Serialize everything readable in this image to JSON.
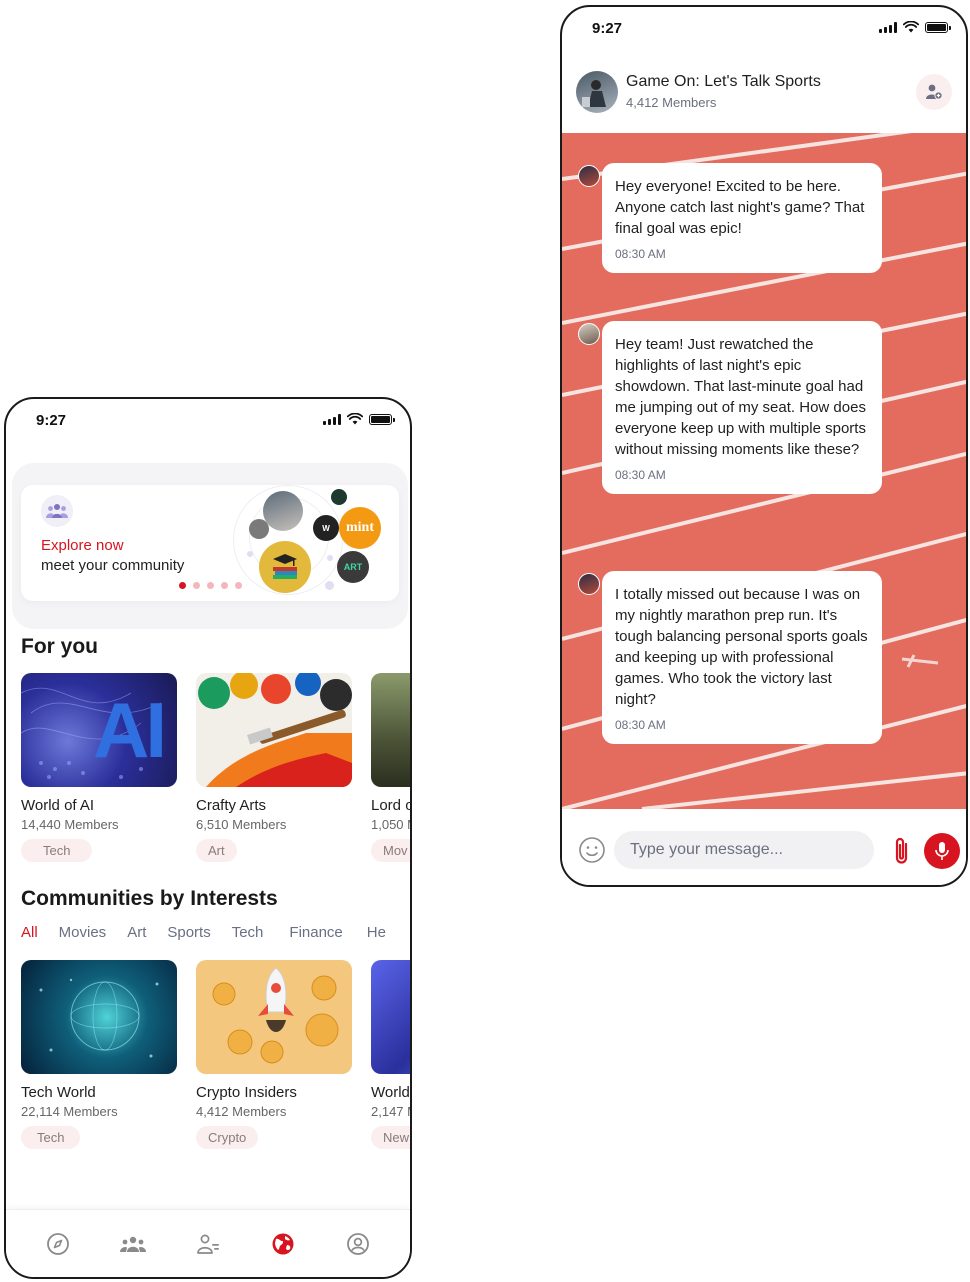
{
  "left_phone": {
    "status": {
      "time": "9:27"
    },
    "banner": {
      "explore": "Explore now",
      "meet": "meet your community",
      "dots_total": 5,
      "dots_active": 1,
      "bubble_labels": {
        "mint": "mint",
        "art": "ART"
      }
    },
    "for_you": {
      "title": "For you",
      "cards": [
        {
          "name": "World of AI",
          "members": "14,440 Members",
          "tag": "Tech",
          "image_text": "AI"
        },
        {
          "name": "Crafty Arts",
          "members": "6,510 Members",
          "tag": "Art"
        },
        {
          "name": "Lord o",
          "members": "1,050 M",
          "tag": "Mov"
        }
      ]
    },
    "interests": {
      "title": "Communities by Interests",
      "tabs": [
        "All",
        "Movies",
        "Art",
        "Sports",
        "Tech",
        "Finance",
        "He"
      ],
      "active_tab": "All",
      "cards": [
        {
          "name": "Tech World",
          "members": "22,114 Members",
          "tag": "Tech"
        },
        {
          "name": "Crypto Insiders",
          "members": "4,412 Members",
          "tag": "Crypto"
        },
        {
          "name": "World",
          "members": "2,147 M",
          "tag": "New"
        }
      ]
    },
    "bottom_nav": [
      {
        "icon": "compass-icon",
        "active": false
      },
      {
        "icon": "community-icon",
        "active": false
      },
      {
        "icon": "users-icon",
        "active": false
      },
      {
        "icon": "globe-icon",
        "active": true
      },
      {
        "icon": "profile-icon",
        "active": false
      }
    ]
  },
  "right_phone": {
    "status": {
      "time": "9:27"
    },
    "header": {
      "title": "Game On: Let's Talk Sports",
      "members": "4,412 Members"
    },
    "messages": [
      {
        "text": "Hey everyone! Excited to be here. Anyone catch last night's game? That final goal was epic!",
        "time": "08:30 AM"
      },
      {
        "text": "Hey team! Just rewatched the highlights of last night's epic showdown. That last-minute goal had me jumping out of my seat. How does everyone keep up with multiple sports without missing moments like these?",
        "time": "08:30 AM"
      },
      {
        "text": "I totally missed out because I was on my nightly marathon prep run. It's tough balancing personal sports goals and keeping up with professional games. Who took the victory last night?",
        "time": "08:30 AM"
      }
    ],
    "composer": {
      "placeholder": "Type your message..."
    }
  },
  "colors": {
    "accent": "#d7141f",
    "track": "#e46c5f",
    "tag_bg": "#fbeeee",
    "muted": "#6b6f80"
  }
}
